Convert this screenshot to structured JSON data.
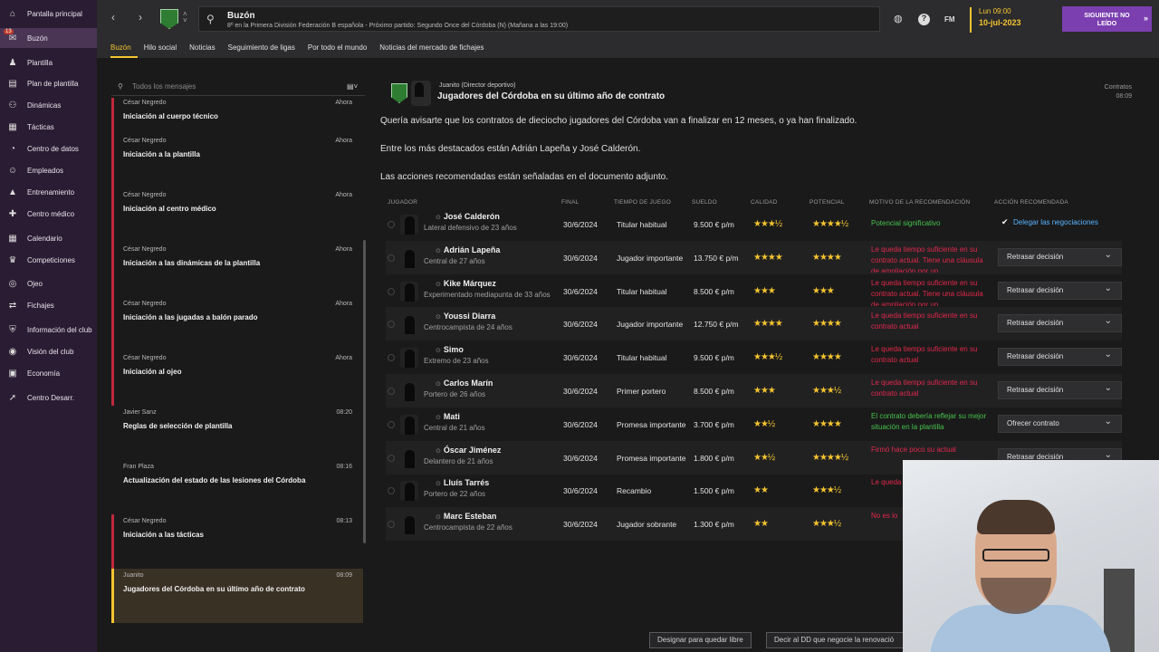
{
  "sidebar": {
    "items": [
      {
        "label": "Pantalla principal",
        "icon": "home-icon",
        "glyph": "⌂"
      },
      {
        "label": "Buzón",
        "icon": "inbox-icon",
        "glyph": "✉",
        "badge": "13",
        "active": true
      },
      {
        "label": "Plantilla",
        "icon": "shirt-icon",
        "glyph": "♟"
      },
      {
        "label": "Plan de plantilla",
        "icon": "clipboard-icon",
        "glyph": "▤"
      },
      {
        "label": "Dinámicas",
        "icon": "people-icon",
        "glyph": "⚇"
      },
      {
        "label": "Tácticas",
        "icon": "tactics-icon",
        "glyph": "▦"
      },
      {
        "label": "Centro de datos",
        "icon": "data-icon",
        "glyph": "◔"
      },
      {
        "label": "Empleados",
        "icon": "staff-icon",
        "glyph": "☺"
      },
      {
        "label": "Entrenamiento",
        "icon": "training-icon",
        "glyph": "▲"
      },
      {
        "label": "Centro médico",
        "icon": "medical-icon",
        "glyph": "✚"
      },
      {
        "label": "Calendario",
        "icon": "calendar-icon",
        "glyph": "▦"
      },
      {
        "label": "Competiciones",
        "icon": "trophy-icon",
        "glyph": "♛"
      },
      {
        "label": "Ojeo",
        "icon": "scouting-icon",
        "glyph": "◎"
      },
      {
        "label": "Fichajes",
        "icon": "transfers-icon",
        "glyph": "⇄"
      },
      {
        "label": "Información del club",
        "icon": "club-info-icon",
        "glyph": "⛨"
      },
      {
        "label": "Visión del club",
        "icon": "club-vision-icon",
        "glyph": "◉"
      },
      {
        "label": "Economía",
        "icon": "finance-icon",
        "glyph": "▣"
      },
      {
        "label": "Centro Desarr.",
        "icon": "development-icon",
        "glyph": "➚"
      }
    ]
  },
  "topbar": {
    "title": "Buzón",
    "subtitle": "8º en la Primera División Federación B española - Próximo partido: Segundo Once del Córdoba (N) (Mañana a las 19:00)",
    "fm_label": "FM",
    "date_day": "Lun 09:00",
    "date_full": "10-jul-2023",
    "continue_line1": "SIGUIENTE NO",
    "continue_line2": "LEÍDO"
  },
  "tabs": [
    "Buzón",
    "Hilo social",
    "Noticias",
    "Seguimiento de ligas",
    "Por todo el mundo",
    "Noticias del mercado de fichajes"
  ],
  "inbox": {
    "search_placeholder": "Todos los mensajes",
    "messages": [
      {
        "from": "César Negredo",
        "time": "Ahora",
        "subject": "Iniciación al cuerpo técnico",
        "type": "unread"
      },
      {
        "from": "César Negredo",
        "time": "Ahora",
        "subject": "Iniciación a la plantilla",
        "type": "unread"
      },
      {
        "from": "César Negredo",
        "time": "Ahora",
        "subject": "Iniciación al centro médico",
        "type": "unread"
      },
      {
        "from": "César Negredo",
        "time": "Ahora",
        "subject": "Iniciación a las dinámicas de la plantilla",
        "type": "unread"
      },
      {
        "from": "César Negredo",
        "time": "Ahora",
        "subject": "Iniciación a las jugadas a balón parado",
        "type": "unread"
      },
      {
        "from": "César Negredo",
        "time": "Ahora",
        "subject": "Iniciación al ojeo",
        "type": "unread"
      },
      {
        "from": "Javier Sanz",
        "time": "08:20",
        "subject": "Reglas de selección de plantilla",
        "type": "plain"
      },
      {
        "from": "Fran Plaza",
        "time": "08:16",
        "subject": "Actualización del estado de las lesiones del Córdoba",
        "type": "plain"
      },
      {
        "from": "César Negredo",
        "time": "08:13",
        "subject": "Iniciación a las tácticas",
        "type": "unread"
      },
      {
        "from": "Juanito",
        "time": "08:09",
        "subject": "Jugadores del Córdoba en su último año de contrato",
        "type": "selected"
      }
    ]
  },
  "message": {
    "from": "Juanito (Director deportivo)",
    "title": "Jugadores del Córdoba en su último año de contrato",
    "tag": "Contratos",
    "time": "08:09",
    "p1": "Quería avisarte que los contratos de dieciocho jugadores del Córdoba van a finalizar en 12 meses, o ya han finalizado.",
    "p2": "Entre los más destacados están Adrián Lapeña y José Calderón.",
    "p3": "Las acciones recomendadas están señaladas en el documento adjunto."
  },
  "table": {
    "headers": {
      "player": "JUGADOR",
      "end": "FINAL",
      "time": "TIEMPO DE JUEGO",
      "wage": "SUELDO",
      "ability": "CALIDAD",
      "potential": "POTENCIAL",
      "reason": "MOTIVO DE LA RECOMENDACIÓN",
      "action": "ACCIÓN RECOMENDADA"
    },
    "rows": [
      {
        "name": "José Calderón",
        "pos": "Lateral defensivo de 23 años",
        "end": "30/6/2024",
        "time": "Titular habitual",
        "wage": "9.500 € p/m",
        "ability": "★★★½",
        "potential": "★★★★½",
        "reason": "Potencial significativo",
        "reason_color": "green",
        "action": "Delegar las negociaciones",
        "action_type": "link"
      },
      {
        "name": "Adrián Lapeña",
        "pos": "Central de 27 años",
        "end": "30/6/2024",
        "time": "Jugador importante",
        "wage": "13.750 € p/m",
        "ability": "★★★★",
        "potential": "★★★★",
        "reason": "Le queda tiempo suficiente en su contrato actual. Tiene una cláusula de ampliación por un...",
        "reason_color": "red",
        "action": "Retrasar decisión",
        "action_type": "dropdown"
      },
      {
        "name": "Kike Márquez",
        "pos": "Experimentado mediapunta de 33 años",
        "end": "30/6/2024",
        "time": "Titular habitual",
        "wage": "8.500 € p/m",
        "ability": "★★★",
        "potential": "★★★",
        "reason": "Le queda tiempo suficiente en su contrato actual. Tiene una cláusula de ampliación por un...",
        "reason_color": "red",
        "action": "Retrasar decisión",
        "action_type": "dropdown"
      },
      {
        "name": "Youssi Diarra",
        "pos": "Centrocampista de 24 años",
        "end": "30/6/2024",
        "time": "Jugador importante",
        "wage": "12.750 € p/m",
        "ability": "★★★★",
        "potential": "★★★★",
        "reason": "Le queda tiempo suficiente en su contrato actual",
        "reason_color": "red",
        "action": "Retrasar decisión",
        "action_type": "dropdown"
      },
      {
        "name": "Simo",
        "pos": "Extremo de 23 años",
        "end": "30/6/2024",
        "time": "Titular habitual",
        "wage": "9.500 € p/m",
        "ability": "★★★½",
        "potential": "★★★★",
        "reason": "Le queda tiempo suficiente en su contrato actual",
        "reason_color": "red",
        "action": "Retrasar decisión",
        "action_type": "dropdown"
      },
      {
        "name": "Carlos Marín",
        "pos": "Portero de 26 años",
        "end": "30/6/2024",
        "time": "Primer portero",
        "wage": "8.500 € p/m",
        "ability": "★★★",
        "potential": "★★★½",
        "reason": "Le queda tiempo suficiente en su contrato actual",
        "reason_color": "red",
        "action": "Retrasar decisión",
        "action_type": "dropdown"
      },
      {
        "name": "Mati",
        "pos": "Central de 21 años",
        "end": "30/6/2024",
        "time": "Promesa importante",
        "wage": "3.700 € p/m",
        "ability": "★★½",
        "potential": "★★★★",
        "reason": "El contrato debería reflejar su mejor situación en la plantilla",
        "reason_color": "green",
        "action": "Ofrecer contrato",
        "action_type": "dropdown"
      },
      {
        "name": "Óscar Jiménez",
        "pos": "Delantero de 21 años",
        "end": "30/6/2024",
        "time": "Promesa importante",
        "wage": "1.800 € p/m",
        "ability": "★★½",
        "potential": "★★★★½",
        "reason": "Firmó hace poco su actual",
        "reason_color": "red",
        "action": "Retrasar decisión",
        "action_type": "dropdown"
      },
      {
        "name": "Lluís Tarrés",
        "pos": "Portero de 22 años",
        "end": "30/6/2024",
        "time": "Recambio",
        "wage": "1.500 € p/m",
        "ability": "★★",
        "potential": "★★★½",
        "reason": "Le queda",
        "reason_color": "red",
        "action": "",
        "action_type": "none"
      },
      {
        "name": "Marc Esteban",
        "pos": "Centrocampista de 22 años",
        "end": "30/6/2024",
        "time": "Jugador sobrante",
        "wage": "1.300 € p/m",
        "ability": "★★",
        "potential": "★★★½",
        "reason": "No es lo",
        "reason_color": "red",
        "action": "",
        "action_type": "none"
      }
    ]
  },
  "buttons": {
    "release": "Designar para quedar libre",
    "delegate": "Decir al DD que negocie la renovació"
  },
  "colors": {
    "accent": "#f4c430",
    "sidebar": "#2a1c32",
    "unread": "#c0283b",
    "link": "#5ab4ff",
    "red": "#e0284a",
    "green": "#46c34e",
    "button": "#7b3fb0"
  }
}
